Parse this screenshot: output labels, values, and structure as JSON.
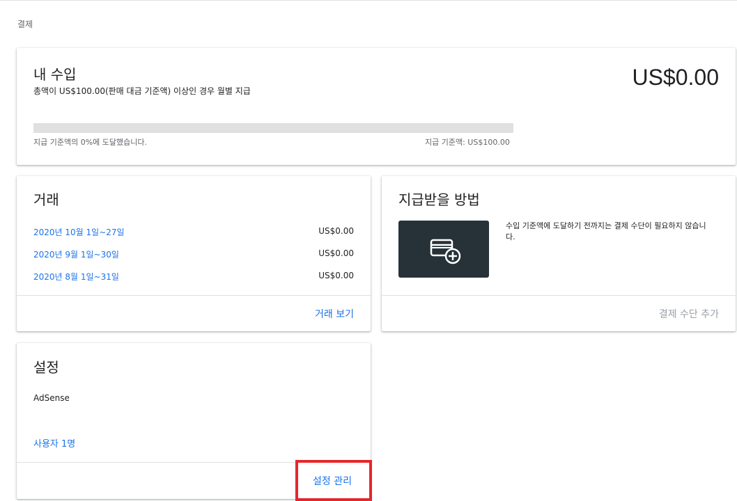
{
  "breadcrumb": "결제",
  "earnings": {
    "title": "내 수입",
    "subtitle": "총액이 US$100.00(판매 대금 기준액) 이상인 경우 월별 지급",
    "balance": "US$0.00",
    "progress_percent": 0,
    "progress_text": "지급 기준액의 0%에 도달했습니다.",
    "threshold_text": "지급 기준액: US$100.00"
  },
  "transactions": {
    "title": "거래",
    "rows": [
      {
        "date": "2020년 10월 1일~27일",
        "amount": "US$0.00"
      },
      {
        "date": "2020년 9월 1일~30일",
        "amount": "US$0.00"
      },
      {
        "date": "2020년 8월 1일~31일",
        "amount": "US$0.00"
      }
    ],
    "action": "거래 보기"
  },
  "payment": {
    "title": "지급받을 방법",
    "icon": "add-card-icon",
    "description": "수입 기준액에 도달하기 전까지는 결제 수단이 필요하지 않습니다.",
    "action": "결제 수단 추가"
  },
  "settings": {
    "title": "설정",
    "account": "AdSense",
    "users": "사용자 1명",
    "action": "설정 관리"
  },
  "colors": {
    "link": "#1a73e8",
    "highlight": "#e5262c",
    "tile": "#263238"
  }
}
